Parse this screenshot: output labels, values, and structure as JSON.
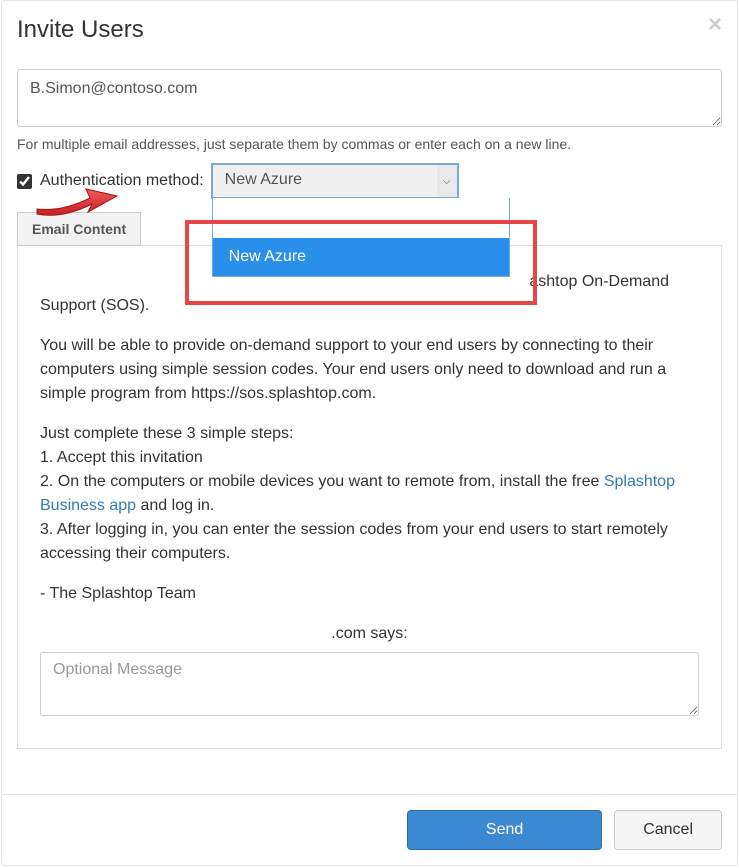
{
  "modal": {
    "title": "Invite Users",
    "close_symbol": "×"
  },
  "email_field": {
    "value": "B.Simon@contoso.com",
    "helper": "For multiple email addresses, just separate them by commas or enter each on a new line."
  },
  "auth": {
    "checked": true,
    "label": "Authentication method:",
    "selected": "New Azure",
    "options": [
      "New Azure"
    ]
  },
  "tabs": {
    "email_content": "Email Content"
  },
  "content": {
    "line1_suffix": "ashtop On-Demand",
    "line1b": "Support (SOS).",
    "p2": "You will be able to provide on-demand support to your end users by connecting to their computers using simple session codes. Your end users only need to download and run a simple program from https://sos.splashtop.com.",
    "steps_intro": "Just complete these 3 simple steps:",
    "step1": "1. Accept this invitation",
    "step2a": "2. On the computers or mobile devices you want to remote from, install the free ",
    "step2_link": "Splashtop Business app",
    "step2b": " and log in.",
    "step3": "3. After logging in, you can enter the session codes from your end users to start remotely accessing their computers.",
    "signoff": "- The Splashtop Team",
    "com_says": ".com says:",
    "optional_placeholder": "Optional Message"
  },
  "footer": {
    "send": "Send",
    "cancel": "Cancel"
  }
}
